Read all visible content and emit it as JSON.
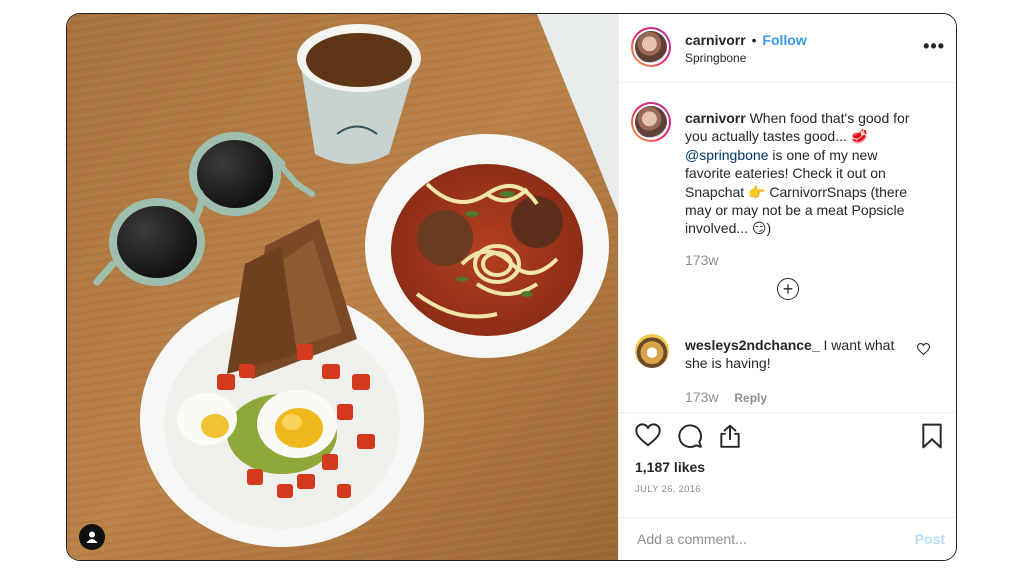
{
  "post": {
    "photo": {
      "subject": "food photo with sunglasses, coffee cup, toast bowl and meatball zucchini noodle soup",
      "user_tag_icon": "user-icon"
    },
    "header": {
      "username": "carnivorr",
      "separator": "•",
      "follow_label": "Follow",
      "location": "Springbone",
      "more_icon": "more-horizontal-icon",
      "more_label": "•••"
    },
    "caption": {
      "username": "carnivorr",
      "text_1": " When food that's good for you actually tastes good... 🥩 ",
      "mention": "@springbone",
      "text_2": " is one of my new favorite eateries! Check it out on Snapchat 👉 CarnivorrSnaps (there may or may not be a meat Popsicle involved... 😏)",
      "time": "173w"
    },
    "load_more_label": "+",
    "comment": {
      "username": "wesleys2ndchance_",
      "text": " I want what she is having!",
      "time": "173w",
      "reply_label": "Reply"
    },
    "actions": {
      "like_icon": "heart-icon",
      "comment_icon": "comment-icon",
      "share_icon": "share-icon",
      "save_icon": "bookmark-icon"
    },
    "likes": "1,187 likes",
    "date": "JULY 26, 2016",
    "add_comment": {
      "placeholder": "Add a comment...",
      "post_label": "Post"
    },
    "colors": {
      "link_blue": "#3897f0",
      "mention": "#00376b",
      "muted": "#8e8e8e",
      "post_disabled": "#b2dffc"
    }
  }
}
